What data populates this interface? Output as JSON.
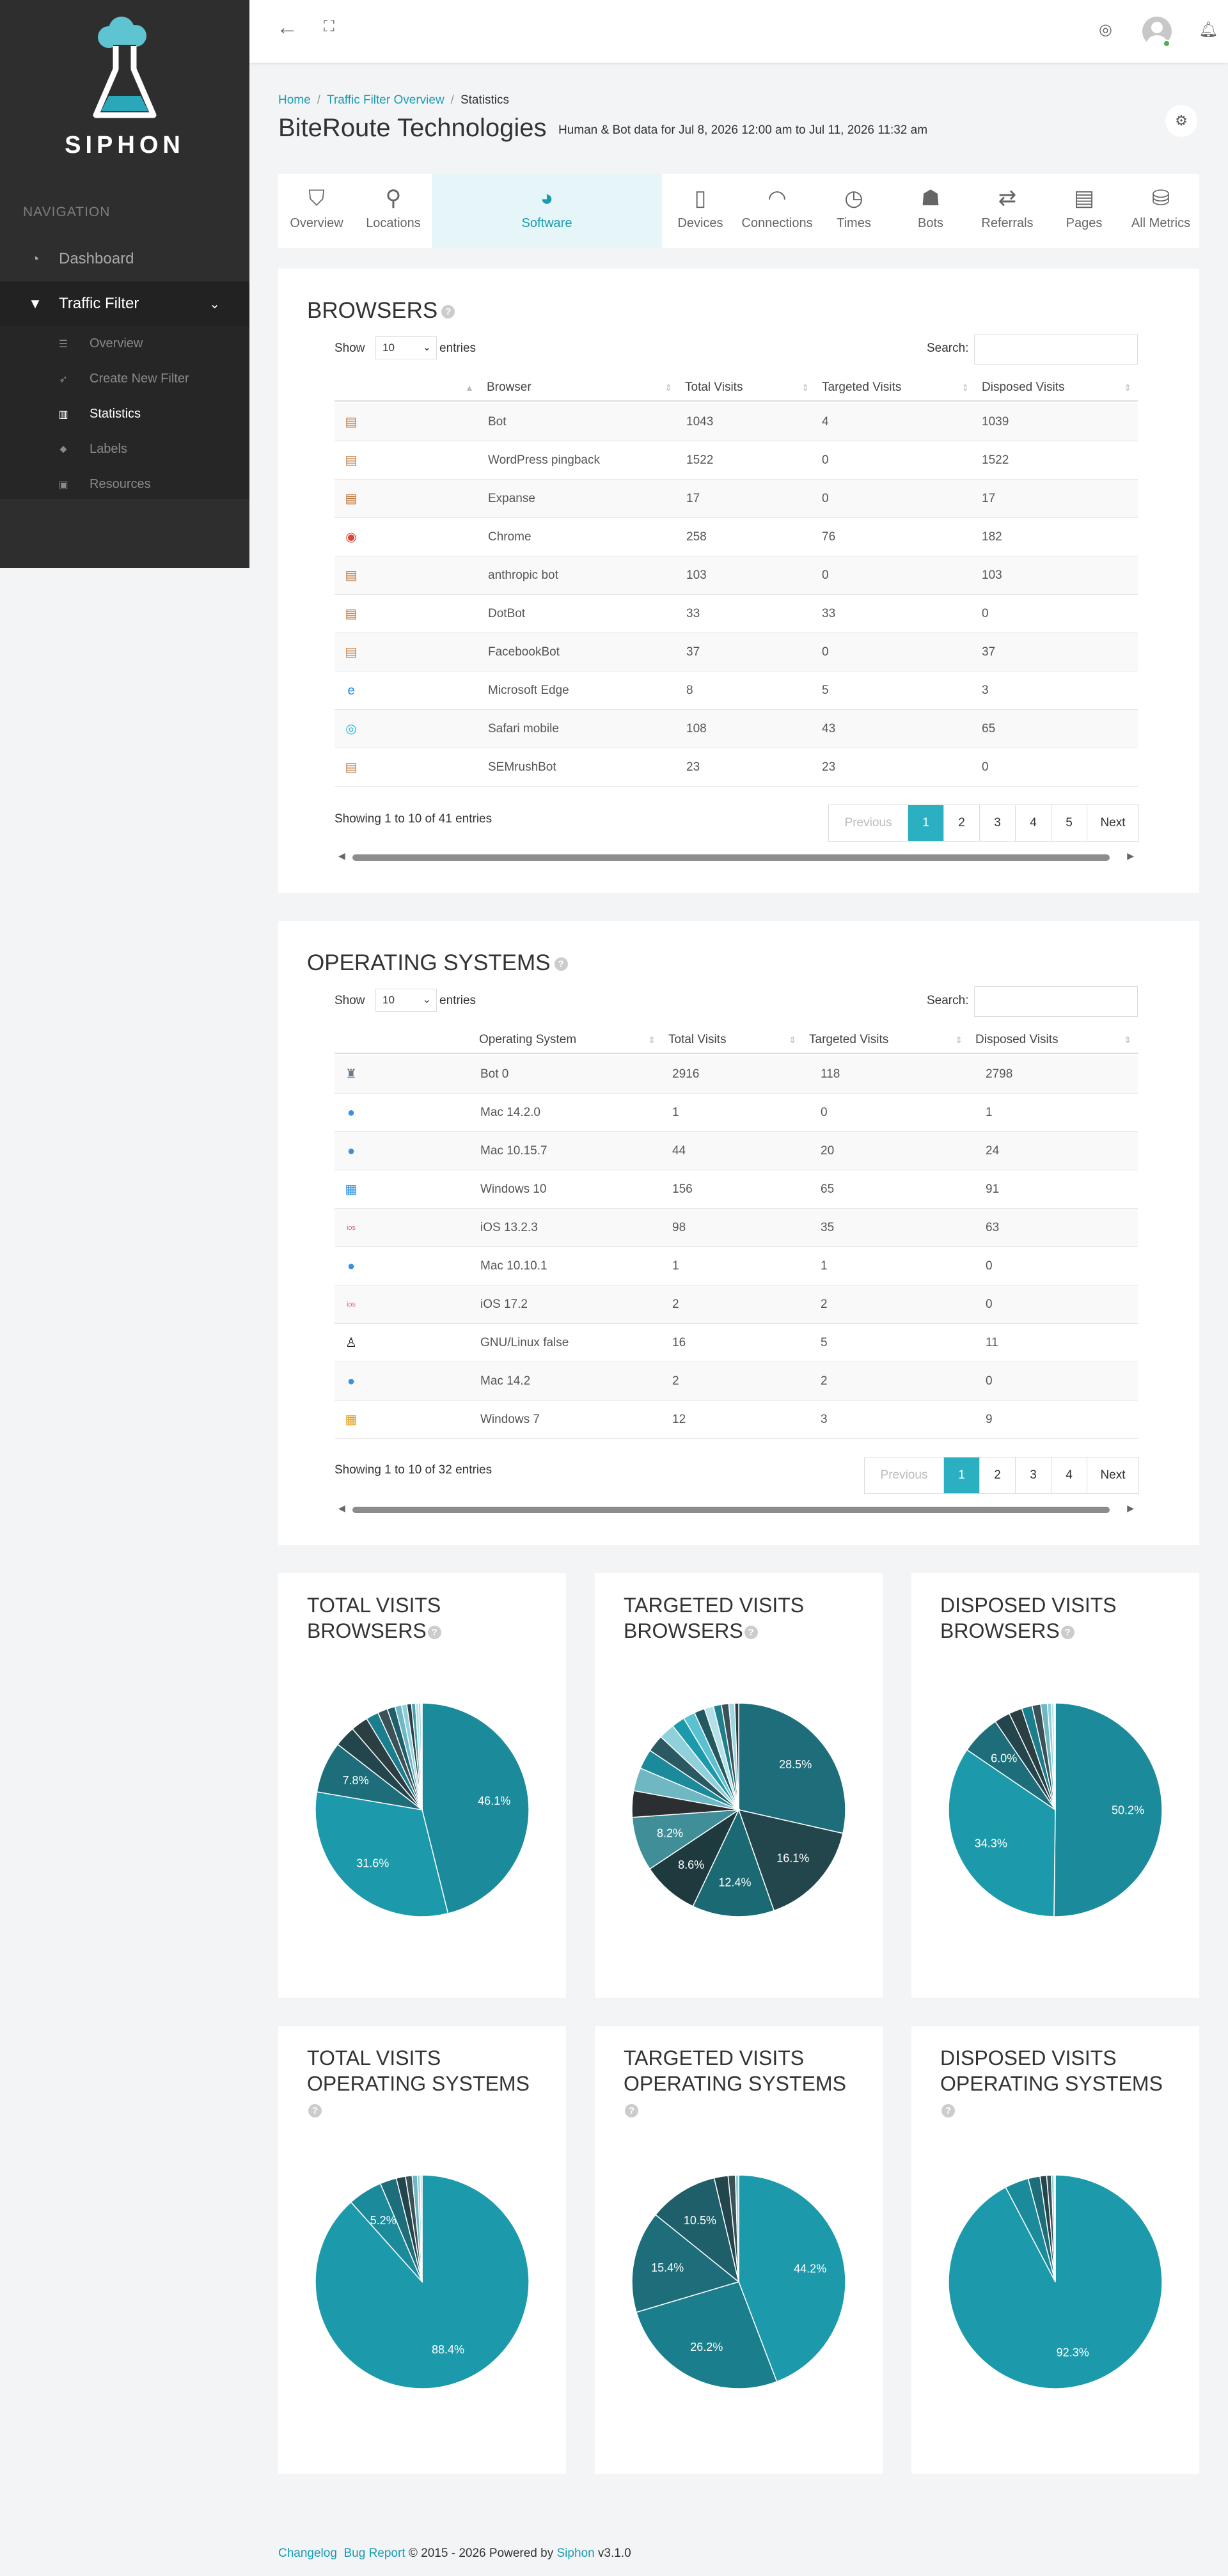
{
  "app": {
    "brand": "SIPHON"
  },
  "sidebar": {
    "nav_heading": "NAVIGATION",
    "items": [
      {
        "label": "Dashboard",
        "icon": "dashboard-icon"
      },
      {
        "label": "Traffic Filter",
        "icon": "filter-icon"
      }
    ],
    "subitems": [
      {
        "label": "Overview",
        "icon": "list-icon"
      },
      {
        "label": "Create New Filter",
        "icon": "rocket-icon"
      },
      {
        "label": "Statistics",
        "icon": "bar-chart-icon",
        "active": true
      },
      {
        "label": "Labels",
        "icon": "tags-icon"
      },
      {
        "label": "Resources",
        "icon": "briefcase-icon"
      }
    ]
  },
  "header": {
    "breadcrumb": [
      "Home",
      "Traffic Filter Overview",
      "Statistics"
    ],
    "title": "BiteRoute Technologies",
    "subtitle": "Human & Bot data for Jul 8, 2026 12:00 am to Jul 11, 2026 11:32 am"
  },
  "tabs": [
    {
      "label": "Overview",
      "icon": "binoculars-icon"
    },
    {
      "label": "Locations",
      "icon": "map-pin-icon"
    },
    {
      "label": "Software",
      "icon": "palette-icon",
      "active": true
    },
    {
      "label": "Devices",
      "icon": "mobile-icon"
    },
    {
      "label": "Connections",
      "icon": "wifi-icon"
    },
    {
      "label": "Times",
      "icon": "clock-icon"
    },
    {
      "label": "Bots",
      "icon": "user-secret-icon"
    },
    {
      "label": "Referrals",
      "icon": "exchange-icon"
    },
    {
      "label": "Pages",
      "icon": "file-icon"
    },
    {
      "label": "All Metrics",
      "icon": "database-icon"
    }
  ],
  "browsers": {
    "title": "BROWSERS",
    "show_label": "Show",
    "entries_label": "entries",
    "length": "10",
    "search_label": "Search:",
    "columns": [
      "Browser",
      "Total Visits",
      "Targeted Visits",
      "Disposed Visits"
    ],
    "rows": [
      {
        "icon": "generic-browser-icon",
        "name": "Bot",
        "total": "1043",
        "targeted": "4",
        "disposed": "1039"
      },
      {
        "icon": "generic-browser-icon",
        "name": "WordPress pingback",
        "total": "1522",
        "targeted": "0",
        "disposed": "1522"
      },
      {
        "icon": "generic-browser-icon",
        "name": "Expanse",
        "total": "17",
        "targeted": "0",
        "disposed": "17"
      },
      {
        "icon": "chrome-icon",
        "name": "Chrome",
        "total": "258",
        "targeted": "76",
        "disposed": "182"
      },
      {
        "icon": "generic-browser-icon",
        "name": "anthropic bot",
        "total": "103",
        "targeted": "0",
        "disposed": "103"
      },
      {
        "icon": "generic-browser-icon",
        "name": "DotBot",
        "total": "33",
        "targeted": "33",
        "disposed": "0"
      },
      {
        "icon": "generic-browser-icon",
        "name": "FacebookBot",
        "total": "37",
        "targeted": "0",
        "disposed": "37"
      },
      {
        "icon": "edge-icon",
        "name": "Microsoft Edge",
        "total": "8",
        "targeted": "5",
        "disposed": "3"
      },
      {
        "icon": "safari-icon",
        "name": "Safari mobile",
        "total": "108",
        "targeted": "43",
        "disposed": "65"
      },
      {
        "icon": "generic-browser-icon",
        "name": "SEMrushBot",
        "total": "23",
        "targeted": "23",
        "disposed": "0"
      }
    ],
    "info": "Showing 1 to 10 of 41 entries",
    "pages": [
      "Previous",
      "1",
      "2",
      "3",
      "4",
      "5",
      "Next"
    ]
  },
  "os": {
    "title": "OPERATING SYSTEMS",
    "show_label": "Show",
    "entries_label": "entries",
    "length": "10",
    "search_label": "Search:",
    "columns": [
      "Operating System",
      "Total Visits",
      "Targeted Visits",
      "Disposed Visits"
    ],
    "rows": [
      {
        "icon": "android-bot-icon",
        "name": "Bot 0",
        "total": "2916",
        "targeted": "118",
        "disposed": "2798"
      },
      {
        "icon": "apple-icon",
        "name": "Mac 14.2.0",
        "total": "1",
        "targeted": "0",
        "disposed": "1"
      },
      {
        "icon": "apple-icon",
        "name": "Mac 10.15.7",
        "total": "44",
        "targeted": "20",
        "disposed": "24"
      },
      {
        "icon": "windows-icon",
        "name": "Windows 10",
        "total": "156",
        "targeted": "65",
        "disposed": "91"
      },
      {
        "icon": "ios-icon",
        "name": "iOS 13.2.3",
        "total": "98",
        "targeted": "35",
        "disposed": "63"
      },
      {
        "icon": "apple-icon",
        "name": "Mac 10.10.1",
        "total": "1",
        "targeted": "1",
        "disposed": "0"
      },
      {
        "icon": "ios-icon",
        "name": "iOS 17.2",
        "total": "2",
        "targeted": "2",
        "disposed": "0"
      },
      {
        "icon": "linux-icon",
        "name": "GNU/Linux false",
        "total": "16",
        "targeted": "5",
        "disposed": "11"
      },
      {
        "icon": "apple-icon",
        "name": "Mac 14.2",
        "total": "2",
        "targeted": "2",
        "disposed": "0"
      },
      {
        "icon": "windows-legacy-icon",
        "name": "Windows 7",
        "total": "12",
        "targeted": "3",
        "disposed": "9"
      }
    ],
    "info": "Showing 1 to 10 of 32 entries",
    "pages": [
      "Previous",
      "1",
      "2",
      "3",
      "4",
      "Next"
    ]
  },
  "colors": {
    "accent": "#1a9bb0",
    "pager_active": "#2ab0c0",
    "sidebar": "#2e2e2e"
  },
  "chart_data": [
    {
      "type": "pie",
      "title_line1": "TOTAL VISITS",
      "title_line2": "BROWSERS",
      "values": [
        46.1,
        31.6,
        7.8,
        3.2,
        2.6,
        1.9,
        1.5,
        1.2,
        1.0,
        0.8,
        0.7,
        0.6,
        0.5,
        0.3,
        0.2
      ],
      "labels": [
        "46.1%",
        "31.6%",
        "7.8%"
      ],
      "colors": [
        "#1b8a9a",
        "#1c9aab",
        "#1d6e7a",
        "#22464c",
        "#2b3e42",
        "#1b7e8c",
        "#3a5257",
        "#1f5f69",
        "#6fb7c2",
        "#8fd0db",
        "#28424a",
        "#4a9fab",
        "#b4e1e8",
        "#5bc0cf",
        "#d5eef2"
      ]
    },
    {
      "type": "pie",
      "title_line1": "TARGETED VISITS",
      "title_line2": "BROWSERS",
      "values": [
        28.5,
        16.1,
        12.4,
        8.6,
        8.2,
        4.0,
        3.5,
        3.0,
        2.6,
        2.4,
        2.0,
        1.8,
        1.6,
        1.4,
        1.2,
        1.1,
        0.9,
        0.6
      ],
      "labels": [
        "28.5%",
        "16.1%",
        "12.4%",
        "8.6%",
        "8.2%"
      ],
      "colors": [
        "#1d6e7a",
        "#22464c",
        "#1b6a73",
        "#1e3a3f",
        "#3f8e98",
        "#2b2f31",
        "#6fb7c2",
        "#1b8a9a",
        "#2a5961",
        "#8fd0db",
        "#1c9aab",
        "#5bc0cf",
        "#245860",
        "#b4e1e8",
        "#1f7f8d",
        "#3a5257",
        "#9fd6df",
        "#2b3e42"
      ]
    },
    {
      "type": "pie",
      "title_line1": "DISPOSED VISITS",
      "title_line2": "BROWSERS",
      "values": [
        50.2,
        34.3,
        6.0,
        2.4,
        2.0,
        1.6,
        1.3,
        1.0,
        0.6,
        0.4,
        0.2
      ],
      "labels": [
        "50.2%",
        "34.3%",
        "6.0%"
      ],
      "colors": [
        "#1b8a9a",
        "#1c9aab",
        "#1d6e7a",
        "#22464c",
        "#2b3e42",
        "#1b7e8c",
        "#3a5257",
        "#6fb7c2",
        "#8fd0db",
        "#b4e1e8",
        "#d5eef2"
      ]
    },
    {
      "type": "pie",
      "title_line1": "TOTAL VISITS",
      "title_line2": "OPERATING SYSTEMS",
      "values": [
        88.4,
        5.2,
        2.5,
        1.4,
        1.0,
        0.8,
        0.4,
        0.3
      ],
      "labels": [
        "88.4%",
        "5.2%"
      ],
      "colors": [
        "#1c9aab",
        "#1b8a9a",
        "#1d6e7a",
        "#22464c",
        "#3a5257",
        "#6fb7c2",
        "#8fd0db",
        "#b4e1e8"
      ]
    },
    {
      "type": "pie",
      "title_line1": "TARGETED VISITS",
      "title_line2": "OPERATING SYSTEMS",
      "values": [
        44.2,
        26.2,
        15.4,
        10.5,
        2.1,
        1.1,
        0.5
      ],
      "labels": [
        "44.2%",
        "26.2%",
        "15.4%",
        "10.5%"
      ],
      "colors": [
        "#1c9aab",
        "#1b7e8c",
        "#1d6e7a",
        "#1f5f69",
        "#22464c",
        "#3a5257",
        "#8fd0db"
      ]
    },
    {
      "type": "pie",
      "title_line1": "DISPOSED VISITS",
      "title_line2": "OPERATING SYSTEMS",
      "values": [
        92.3,
        3.6,
        1.8,
        1.0,
        0.7,
        0.4,
        0.2
      ],
      "labels": [
        "92.3%"
      ],
      "colors": [
        "#1c9aab",
        "#1b8a9a",
        "#1d6e7a",
        "#22464c",
        "#3a5257",
        "#8fd0db",
        "#b4e1e8"
      ]
    }
  ],
  "footer": {
    "changelog": "Changelog",
    "bug_report": "Bug Report",
    "copyright": " © 2015 - 2026  Powered by ",
    "product": "Siphon",
    "version": " v3.1.0"
  }
}
